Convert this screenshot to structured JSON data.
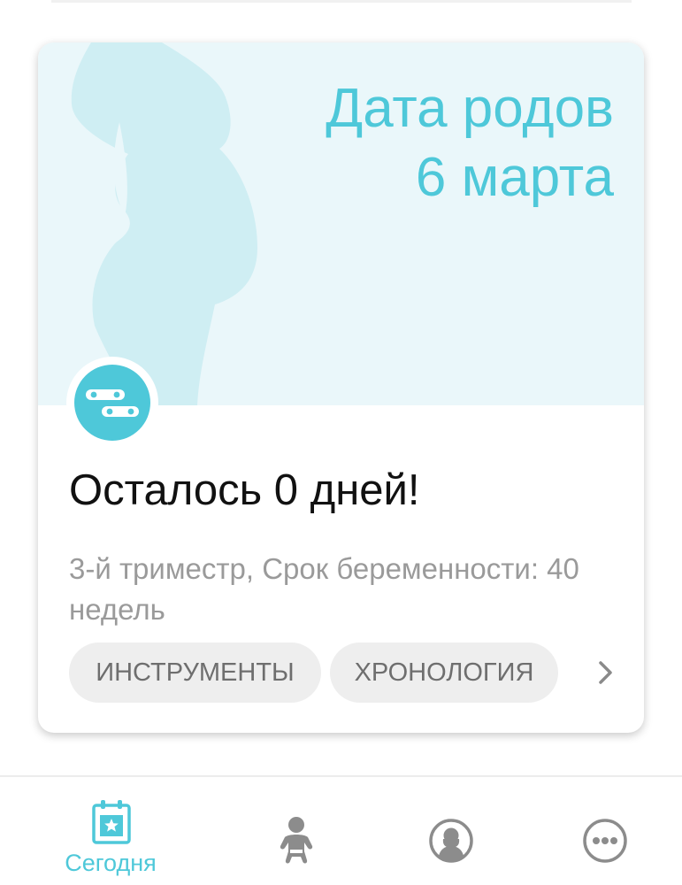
{
  "card": {
    "due_date_line1": "Дата родов",
    "due_date_line2": "6 марта",
    "headline": "Осталось 0 дней!",
    "subtitle": "3-й триместр, Срок беременности: 40 недель",
    "chips": {
      "tools": "ИНСТРУМЕНТЫ",
      "timeline": "ХРОНОЛОГИЯ"
    }
  },
  "bottom_nav": {
    "items": [
      {
        "label": "Сегодня",
        "icon": "calendar-star-icon",
        "active": true
      },
      {
        "label": "",
        "icon": "baby-icon",
        "active": false
      },
      {
        "label": "",
        "icon": "community-icon",
        "active": false
      },
      {
        "label": "",
        "icon": "more-icon",
        "active": false
      }
    ]
  },
  "colors": {
    "accent": "#4ec8d9",
    "hero_background": "#eaf7fa",
    "silhouette": "#cfeef3",
    "chip_background": "#eeeeee",
    "inactive_icon": "#8c8c8c"
  }
}
